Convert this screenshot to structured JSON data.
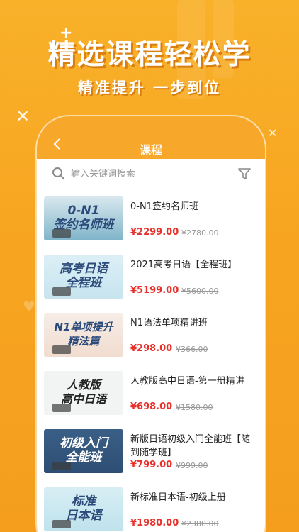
{
  "promo": {
    "title": "精选课程轻松学",
    "subtitle": "精准提升 一步到位"
  },
  "app": {
    "header_title": "课程",
    "search_placeholder": "输入关键词搜索"
  },
  "courses": [
    {
      "name": "0-N1签约名师班",
      "price": "¥2299.00",
      "original": "¥2780.00",
      "thumb_text": "0-N1\n签约名师班"
    },
    {
      "name": "2021高考日语【全程班】",
      "price": "¥5199.00",
      "original": "¥5600.00",
      "thumb_text": "高考日语\n全程班"
    },
    {
      "name": "N1语法单项精讲班",
      "price": "¥298.00",
      "original": "¥366.00",
      "thumb_text": "N1单项提升\n精法篇"
    },
    {
      "name": "人教版高中日语-第一册精讲",
      "price": "¥698.00",
      "original": "¥1580.00",
      "thumb_text": "人教版\n高中日语"
    },
    {
      "name": "新版日语初级入门全能班【随到随学班】",
      "price": "¥799.00",
      "original": "¥999.00",
      "thumb_text": "初级入门\n全能班"
    },
    {
      "name": "新标准日本语-初级上册",
      "price": "¥1980.00",
      "original": "¥2380.00",
      "thumb_text": "标准\n日本语"
    }
  ],
  "colors": {
    "background": "#F7A521",
    "header": "#F7A72A",
    "price": "#E8312B"
  },
  "icons": {
    "back": "chevron-left-icon",
    "search": "search-icon",
    "filter": "filter-funnel-icon"
  }
}
